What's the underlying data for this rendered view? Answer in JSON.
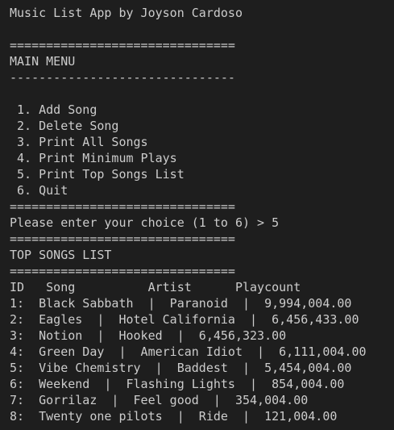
{
  "terminal": {
    "lines": [
      "Music List App by Joyson Cardoso",
      "",
      "===============================",
      "MAIN MENU",
      "-------------------------------",
      "",
      " 1. Add Song",
      " 2. Delete Song",
      " 3. Print All Songs",
      " 4. Print Minimum Plays",
      " 5. Print Top Songs List",
      " 6. Quit",
      "===============================",
      "Please enter your choice (1 to 6) > 5",
      "===============================",
      "TOP SONGS LIST",
      "===============================",
      "ID   Song          Artist      Playcount",
      "1:  Black Sabbath  |  Paranoid  |  9,994,004.00",
      "2:  Eagles  |  Hotel California  |  6,456,433.00",
      "3:  Notion  |  Hooked  |  6,456,323.00",
      "4:  Green Day  |  American Idiot  |  6,111,004.00",
      "5:  Vibe Chemistry  |  Baddest  |  5,454,004.00",
      "6:  Weekend  |  Flashing Lights  |  854,004.00",
      "7:  Gorrilaz  |  Feel good  |  354,004.00",
      "8:  Twenty one pilots  |  Ride  |  121,004.00"
    ]
  },
  "colors": {
    "background": "#1e1e1e",
    "text": "#cccccc"
  }
}
